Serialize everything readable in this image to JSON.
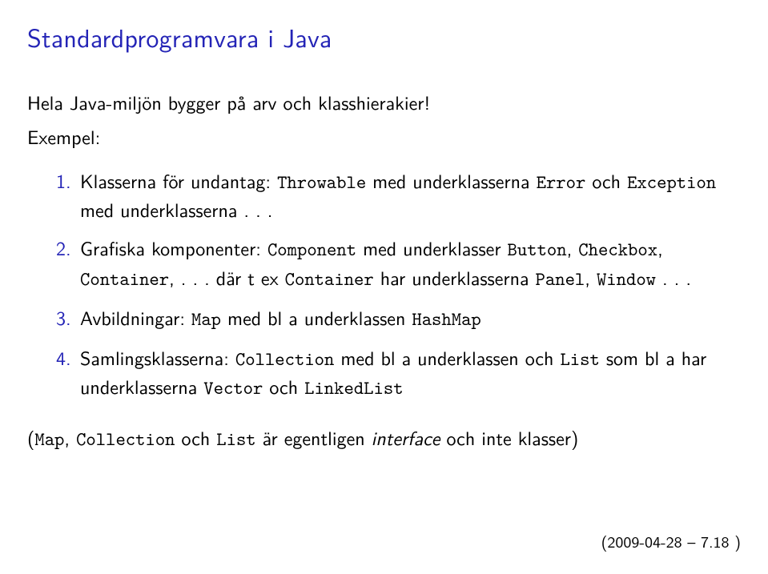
{
  "title": "Standardprogramvara i Java",
  "intro": "Hela Java-miljön bygger på arv och klasshierakier!",
  "example_label": "Exempel:",
  "items": [
    {
      "num": "1.",
      "pre": "Klasserna för undantag: ",
      "c1": "Throwable",
      "mid1": " med underklasserna ",
      "c2": "Error",
      "mid2": " och ",
      "c3": "Exception",
      "post": " med underklasserna . . ."
    },
    {
      "num": "2.",
      "pre": "Grafiska komponenter: ",
      "c1": "Component",
      "mid1": " med underklasser ",
      "c2": "Button",
      "sep1": ", ",
      "c3": "Checkbox",
      "sep2": ", ",
      "c4": "Container",
      "mid2": ", . . . där t ex ",
      "c5": "Container",
      "mid3": " har underklasserna ",
      "c6": "Panel",
      "sep3": ", ",
      "c7": "Window",
      "post": " . . ."
    },
    {
      "num": "3.",
      "pre": "Avbildningar: ",
      "c1": "Map",
      "mid1": " med bl a underklassen ",
      "c2": "HashMap",
      "post": ""
    },
    {
      "num": "4.",
      "pre": "Samlingsklasserna: ",
      "c1": "Collection",
      "mid1": " med bl a underklassen och ",
      "c2": "List",
      "mid2": " som bl a har underklasserna ",
      "c3": "Vector",
      "mid3": " och ",
      "c4": "LinkedList",
      "post": ""
    }
  ],
  "note": {
    "open": "(",
    "c1": "Map",
    "sep1": ", ",
    "c2": "Collection",
    "mid1": " och ",
    "c3": "List",
    "mid2": " är egentligen ",
    "ital": "interface",
    "post": " och inte klasser)"
  },
  "footer": "(2009-04-28 – 7.18 )"
}
